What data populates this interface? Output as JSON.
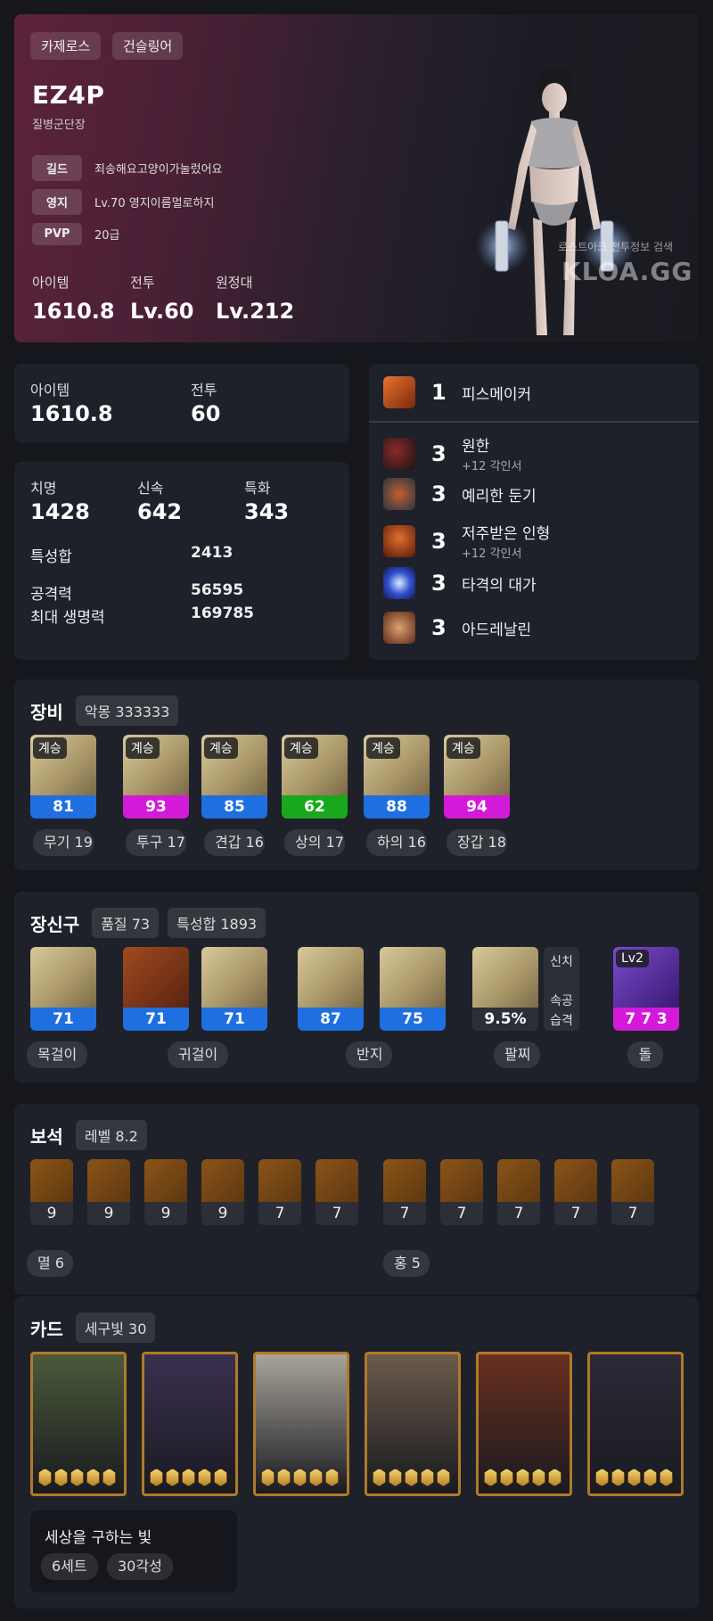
{
  "profile": {
    "server": "카제로스",
    "class": "건슬링어",
    "name": "EZ4P",
    "title": "질병군단장",
    "info": [
      {
        "label": "길드",
        "value": "죄송해요고양이가눌렀어요"
      },
      {
        "label": "영지",
        "value": "Lv.70 영지이름멀로하지"
      },
      {
        "label": "PVP",
        "value": "20급"
      }
    ],
    "stats": [
      {
        "label": "아이템",
        "value": "1610.8"
      },
      {
        "label": "전투",
        "value": "Lv.60"
      },
      {
        "label": "원정대",
        "value": "Lv.212"
      }
    ],
    "watermark_small": "로스트아크 전투정보 검색",
    "watermark_big": "KLOA.GG"
  },
  "summary": {
    "item_label": "아이템",
    "item_value": "1610.8",
    "combat_label": "전투",
    "combat_value": "60"
  },
  "combat_stats": {
    "crit_label": "치명",
    "crit_value": "1428",
    "swift_label": "신속",
    "swift_value": "642",
    "spec_label": "특화",
    "spec_value": "343",
    "total_label": "특성합",
    "total_value": "2413",
    "atk_label": "공격력",
    "atk_value": "56595",
    "hp_label": "최대 생명력",
    "hp_value": "169785"
  },
  "engravings": [
    {
      "level": "1",
      "name": "피스메이커",
      "sub": "",
      "icon": "peacemaker-icon",
      "color": "#c9531f"
    },
    {
      "level": "3",
      "name": "원한",
      "sub": "+12 각인서",
      "icon": "grudge-icon",
      "color": "#3a2a2a"
    },
    {
      "level": "3",
      "name": "예리한 둔기",
      "sub": "",
      "icon": "keen-blunt-icon",
      "color": "#3a4a5a"
    },
    {
      "level": "3",
      "name": "저주받은 인형",
      "sub": "+12 각인서",
      "icon": "cursed-doll-icon",
      "color": "#8a3018"
    },
    {
      "level": "3",
      "name": "타격의 대가",
      "sub": "",
      "icon": "hit-master-icon",
      "color": "#3050c0"
    },
    {
      "level": "3",
      "name": "아드레날린",
      "sub": "",
      "icon": "adrenaline-icon",
      "color": "#9a5a30"
    }
  ],
  "equipment": {
    "title": "장비",
    "tag": "악몽 333333",
    "items": [
      {
        "badge": "계승",
        "quality": "81",
        "label": "무기 19",
        "color": "#1f6fe0",
        "icon": "weapon-icon"
      },
      {
        "badge": "계승",
        "quality": "93",
        "label": "투구 17",
        "color": "#d21ad8",
        "icon": "helmet-icon"
      },
      {
        "badge": "계승",
        "quality": "85",
        "label": "견갑 16",
        "color": "#1f6fe0",
        "icon": "shoulder-icon"
      },
      {
        "badge": "계승",
        "quality": "62",
        "label": "상의 17",
        "color": "#19a81d",
        "icon": "chest-icon"
      },
      {
        "badge": "계승",
        "quality": "88",
        "label": "하의 16",
        "color": "#1f6fe0",
        "icon": "pants-icon"
      },
      {
        "badge": "계승",
        "quality": "94",
        "label": "장갑 18",
        "color": "#d21ad8",
        "icon": "gloves-icon"
      }
    ]
  },
  "accessories": {
    "title": "장신구",
    "tags": [
      "품질 73",
      "특성합 1893"
    ],
    "items": [
      {
        "quality": "71",
        "color": "#1f6fe0",
        "icon": "necklace-icon"
      },
      {
        "quality": "71",
        "color": "#1f6fe0",
        "icon": "earring-icon"
      },
      {
        "quality": "71",
        "color": "#1f6fe0",
        "icon": "earring-icon"
      },
      {
        "quality": "87",
        "color": "#1f6fe0",
        "icon": "ring-icon"
      },
      {
        "quality": "75",
        "color": "#1f6fe0",
        "icon": "ring-icon"
      },
      {
        "quality": "9.5%",
        "color": "#2c2f38",
        "icon": "bracelet-icon"
      },
      {
        "quality": "7 7 3",
        "color": "#d21ad8",
        "icon": "stone-icon",
        "badge": "Lv2"
      }
    ],
    "labels": [
      "목걸이",
      "귀걸이",
      "반지",
      "팔찌",
      "돌"
    ],
    "bracelet_stats": [
      "신치",
      "속공",
      "습격"
    ]
  },
  "gems": {
    "title": "보석",
    "tag": "레벨 8.2",
    "left": [
      "9",
      "9",
      "9",
      "9",
      "7",
      "7"
    ],
    "right": [
      "7",
      "7",
      "7",
      "7",
      "7"
    ],
    "left_label": "멸 6",
    "right_label": "홍 5"
  },
  "cards": {
    "title": "카드",
    "tag": "세구빛 30",
    "set_name": "세상을 구하는 빛",
    "set_count": "6세트",
    "awaken": "30각성",
    "items": [
      {
        "icon": "card-elf-icon",
        "bg": "#4a5a3a"
      },
      {
        "icon": "card-twins-icon",
        "bg": "#3a3050"
      },
      {
        "icon": "card-angel-icon",
        "bg": "#a8a49a"
      },
      {
        "icon": "card-knight-icon",
        "bg": "#6a5a4a"
      },
      {
        "icon": "card-armored-icon",
        "bg": "#6a3020"
      },
      {
        "icon": "card-warrior-icon",
        "bg": "#2a2a38"
      }
    ]
  }
}
